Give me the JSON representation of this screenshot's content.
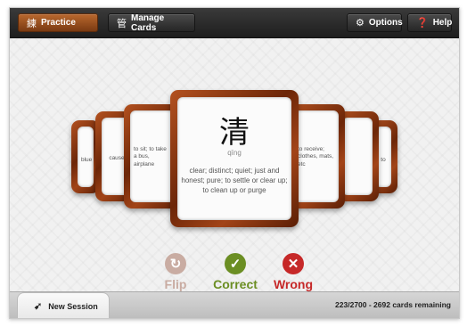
{
  "toolbar": {
    "practice_icon": "練",
    "practice_label": "Practice",
    "manage_icon": "管",
    "manage_label": "Manage Cards",
    "options_label": "Options",
    "help_label": "Help"
  },
  "cards": {
    "left1_def": "blue",
    "left2_def": "cause",
    "left3_def": "to sit; to take a bus, airplane",
    "right3_def": "to receive; clothes, mats, etc",
    "right2_def": "",
    "right1_def": "to",
    "main": {
      "glyph": "清",
      "pinyin": "qīng",
      "definition": "clear; distinct; quiet; just and honest; pure; to settle or clear up; to clean up or purge"
    }
  },
  "actions": {
    "flip_label": "Flip",
    "correct_label": "Correct",
    "wrong_label": "Wrong"
  },
  "footer": {
    "new_session_label": "New Session",
    "status_text": "223/2700 - 2692 cards remaining"
  }
}
